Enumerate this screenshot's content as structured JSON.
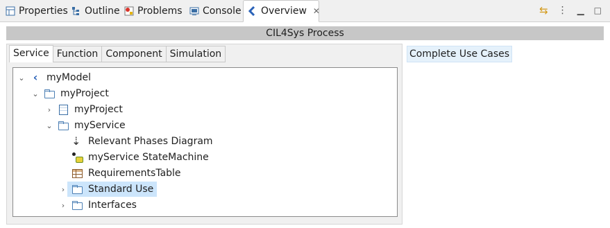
{
  "tabs": [
    {
      "label": "Properties",
      "icon": "properties-icon",
      "active": false
    },
    {
      "label": "Outline",
      "icon": "outline-icon",
      "active": false
    },
    {
      "label": "Problems",
      "icon": "problems-icon",
      "active": false
    },
    {
      "label": "Console",
      "icon": "console-icon",
      "active": false
    },
    {
      "label": "Overview",
      "icon": "overview-icon",
      "active": true
    }
  ],
  "toolbar": {
    "sync_icon": "sync-icon",
    "menu_icon": "view-menu-icon",
    "minimize_icon": "minimize-icon",
    "maximize_icon": "maximize-icon"
  },
  "header": {
    "title": "CIL4Sys Process"
  },
  "subtabs": [
    {
      "label": "Service",
      "active": true
    },
    {
      "label": "Function",
      "active": false
    },
    {
      "label": "Component",
      "active": false
    },
    {
      "label": "Simulation",
      "active": false
    }
  ],
  "tree": [
    {
      "label": "myModel",
      "twisty": "expanded",
      "icon": "model-icon",
      "level": 0,
      "selected": false
    },
    {
      "label": "myProject",
      "twisty": "expanded",
      "icon": "folder-icon",
      "level": 1,
      "selected": false
    },
    {
      "label": "myProject",
      "twisty": "collapsed",
      "icon": "project-icon",
      "level": 2,
      "selected": false
    },
    {
      "label": "myService",
      "twisty": "expanded",
      "icon": "folder-icon",
      "level": 2,
      "selected": false
    },
    {
      "label": "Relevant Phases Diagram",
      "twisty": "none",
      "icon": "phases-diagram-icon",
      "level": 3,
      "selected": false
    },
    {
      "label": "myService StateMachine",
      "twisty": "none",
      "icon": "state-machine-icon",
      "level": 3,
      "selected": false
    },
    {
      "label": "RequirementsTable",
      "twisty": "none",
      "icon": "requirements-table-icon",
      "level": 3,
      "selected": false
    },
    {
      "label": "Standard Use",
      "twisty": "collapsed",
      "icon": "folder-icon",
      "level": 3,
      "selected": true
    },
    {
      "label": "Interfaces",
      "twisty": "collapsed",
      "icon": "folder-icon",
      "level": 3,
      "selected": false
    }
  ],
  "right_panel": {
    "button_label": "Complete Use Cases"
  },
  "colors": {
    "selection": "#cce5fb",
    "header_bar": "#c7c7c7",
    "accent": "#2a62b8"
  }
}
